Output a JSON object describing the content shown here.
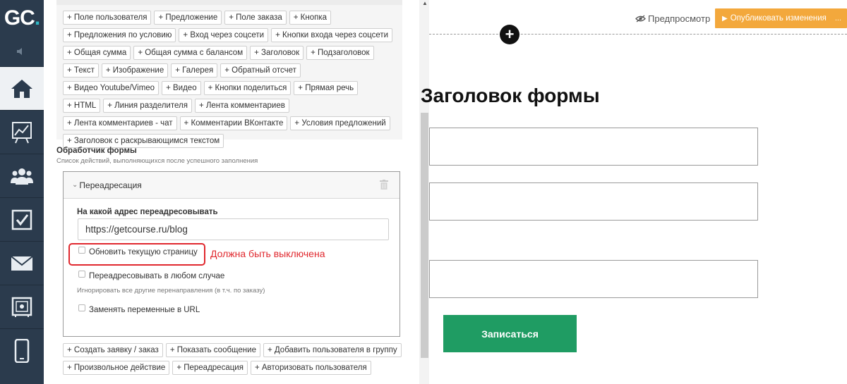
{
  "logo": {
    "text": "GC",
    "dot": "."
  },
  "nav": {
    "items": [
      {
        "icon": "home-icon",
        "active": true
      },
      {
        "icon": "chart-icon"
      },
      {
        "icon": "users-icon"
      },
      {
        "icon": "checkbox-icon"
      },
      {
        "icon": "mail-icon"
      },
      {
        "icon": "safe-icon"
      },
      {
        "icon": "mobile-icon"
      }
    ]
  },
  "blocks": {
    "chips": [
      "+ Поле пользователя",
      "+ Предложение",
      "+ Поле заказа",
      "+ Кнопка",
      "+ Предложения по условию",
      "+ Вход через соцсети",
      "+ Кнопки входа через соцсети",
      "+ Общая сумма",
      "+ Общая сумма с балансом",
      "+ Заголовок",
      "+ Подзаголовок",
      "+ Текст",
      "+ Изображение",
      "+ Галерея",
      "+ Обратный отсчет",
      "+ Видео Youtube/Vimeo",
      "+ Видео",
      "+ Кнопки поделиться",
      "+ Прямая речь",
      "+ HTML",
      "+ Линия разделителя",
      "+ Лента комментариев",
      "+ Лента комментариев - чат",
      "+ Комментарии ВКонтакте",
      "+ Условия предложений",
      "+ Заголовок с раскрывающимся текстом"
    ]
  },
  "handler": {
    "title": "Обработчик формы",
    "subtitle": "Список действий, выполняющихся после успешного заполнения",
    "card": {
      "title": "Переадресация",
      "url_label": "На какой адрес переадресовывать",
      "url_value": "https://getcourse.ru/blog",
      "refresh_label": "Обновить текущую страницу",
      "always_label": "Переадресовывать в любом случае",
      "always_hint": "Игнорировать все другие перенаправления (в т.ч. по заказу)",
      "vars_label": "Заменять переменные в URL"
    },
    "annotation": "Должна быть выключена",
    "action_chips": [
      "+ Создать заявку / заказ",
      "+ Показать сообщение",
      "+ Добавить пользователя в группу",
      "+ Произвольное действие",
      "+ Переадресация",
      "+ Авторизовать пользователя"
    ]
  },
  "preview": {
    "preview_label": "Предпросмотр",
    "publish_label": "Опубликовать изменения",
    "form_title": "Заголовок формы",
    "submit_label": "Записаться"
  },
  "colors": {
    "sidebar": "#2b3b4d",
    "publish": "#f3a83c",
    "submit": "#1f9c63",
    "annotation": "#e0282e"
  }
}
